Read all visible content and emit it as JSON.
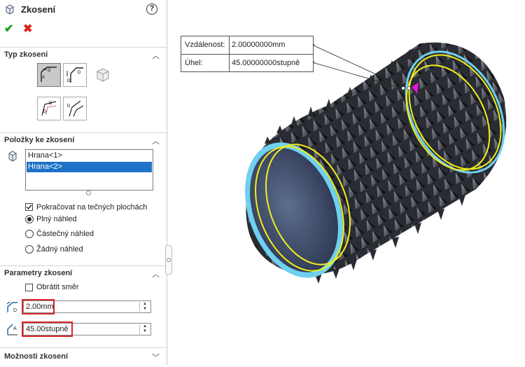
{
  "feature": {
    "title": "Zkosení",
    "help_icon": "?",
    "ok_icon": "✔",
    "cancel_icon": "✖"
  },
  "sections": {
    "type": "Typ zkosení",
    "items": "Položky ke zkosení",
    "params": "Parametry zkosení",
    "options": "Možnosti zkosení"
  },
  "items_list": [
    "Hrana<1>",
    "Hrana<2>"
  ],
  "options": {
    "tangent_propagation": "Pokračovat na tečných plochách",
    "full_preview": "Plný náhled",
    "partial_preview": "Částečný náhled",
    "no_preview": "Žádný náhled",
    "flip_direction": "Obrátit směr"
  },
  "params": {
    "distance_value": "2.00mm",
    "angle_value": "45.00stupně"
  },
  "callout": {
    "distance_label": "Vzdálenost:",
    "distance_value": "2.00000000mm",
    "angle_label": "Úhel:",
    "angle_value": "45.00000000stupně"
  },
  "colors": {
    "accent": "#1e73c8",
    "highlight": "#d9262a",
    "edge_selection": "#f2ee1a",
    "ok": "#1a9a1a"
  }
}
